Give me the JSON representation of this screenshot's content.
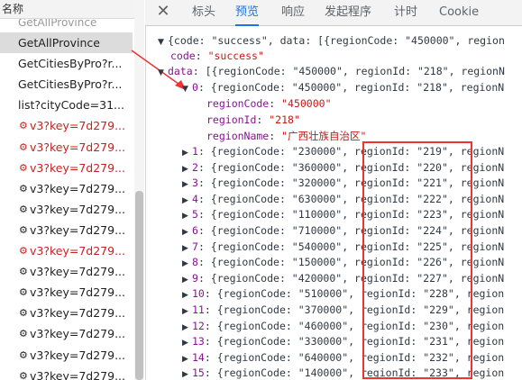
{
  "left_panel": {
    "header": "名称",
    "partial_top": "GetAllProvince",
    "requests": [
      {
        "name": "GetAllProvince",
        "selected": true,
        "red": false,
        "gear": false
      },
      {
        "name": "GetCitiesByPro?r...",
        "selected": false,
        "red": false,
        "gear": false
      },
      {
        "name": "GetCitiesByPro?r...",
        "selected": false,
        "red": false,
        "gear": false
      },
      {
        "name": "list?cityCode=31...",
        "selected": false,
        "red": false,
        "gear": false
      },
      {
        "name": "v3?key=7d279...",
        "selected": false,
        "red": true,
        "gear": true
      },
      {
        "name": "v3?key=7d279...",
        "selected": false,
        "red": true,
        "gear": true
      },
      {
        "name": "v3?key=7d279...",
        "selected": false,
        "red": true,
        "gear": true
      },
      {
        "name": "v3?key=7d279...",
        "selected": false,
        "red": false,
        "gear": true
      },
      {
        "name": "v3?key=7d279...",
        "selected": false,
        "red": false,
        "gear": true
      },
      {
        "name": "v3?key=7d279...",
        "selected": false,
        "red": false,
        "gear": true
      },
      {
        "name": "v3?key=7d279...",
        "selected": false,
        "red": true,
        "gear": true
      },
      {
        "name": "v3?key=7d279...",
        "selected": false,
        "red": false,
        "gear": true
      },
      {
        "name": "v3?key=7d279...",
        "selected": false,
        "red": false,
        "gear": true
      },
      {
        "name": "v3?key=7d279...",
        "selected": false,
        "red": false,
        "gear": true
      },
      {
        "name": "v3?key=7d279...",
        "selected": false,
        "red": false,
        "gear": true
      },
      {
        "name": "v3?key=7d279...",
        "selected": false,
        "red": false,
        "gear": true
      },
      {
        "name": "v3?key=7d279...",
        "selected": false,
        "red": false,
        "gear": true
      }
    ]
  },
  "tabs": {
    "close": "✕",
    "headers": "标头",
    "preview": "预览",
    "response": "响应",
    "initiator": "发起程序",
    "timing": "计时",
    "cookies": "Cookie"
  },
  "preview": {
    "root_summary": "{code: \"success\", data: [{regionCode: \"450000\", region",
    "code_key": "code",
    "code_value": "\"success\"",
    "data_key": "data",
    "data_summary": "[{regionCode: \"450000\", regionId: \"218\", regionN",
    "item0_index": "0",
    "item0_summary": "{regionCode: \"450000\", regionId: \"218\", regionN",
    "item0_fields": [
      {
        "key": "regionCode",
        "value": "\"450000\""
      },
      {
        "key": "regionId",
        "value": "\"218\""
      },
      {
        "key": "regionName",
        "value": "\"广西壮族自治区\""
      }
    ],
    "items": [
      {
        "index": "1",
        "text": "{regionCode: \"230000\", regionId: \"219\", regionN"
      },
      {
        "index": "2",
        "text": "{regionCode: \"360000\", regionId: \"220\", regionN"
      },
      {
        "index": "3",
        "text": "{regionCode: \"320000\", regionId: \"221\", regionN"
      },
      {
        "index": "4",
        "text": "{regionCode: \"630000\", regionId: \"222\", regionN"
      },
      {
        "index": "5",
        "text": "{regionCode: \"110000\", regionId: \"223\", regionN"
      },
      {
        "index": "6",
        "text": "{regionCode: \"710000\", regionId: \"224\", regionN"
      },
      {
        "index": "7",
        "text": "{regionCode: \"540000\", regionId: \"225\", regionN"
      },
      {
        "index": "8",
        "text": "{regionCode: \"150000\", regionId: \"226\", regionN"
      },
      {
        "index": "9",
        "text": "{regionCode: \"420000\", regionId: \"227\", regionN"
      },
      {
        "index": "10",
        "text": "{regionCode: \"510000\", regionId: \"228\", region"
      },
      {
        "index": "11",
        "text": "{regionCode: \"370000\", regionId: \"229\", region"
      },
      {
        "index": "12",
        "text": "{regionCode: \"460000\", regionId: \"230\", region"
      },
      {
        "index": "13",
        "text": "{regionCode: \"330000\", regionId: \"231\", region"
      },
      {
        "index": "14",
        "text": "{regionCode: \"640000\", regionId: \"232\", region"
      },
      {
        "index": "15",
        "text": "{regionCode: \"140000\", regionId: \"233\", region"
      }
    ]
  },
  "colors": {
    "accent": "#1a73e8",
    "highlight_box": "#ee3333",
    "error_text": "#c5221f",
    "json_key": "#881391",
    "json_string": "#c41a16"
  }
}
